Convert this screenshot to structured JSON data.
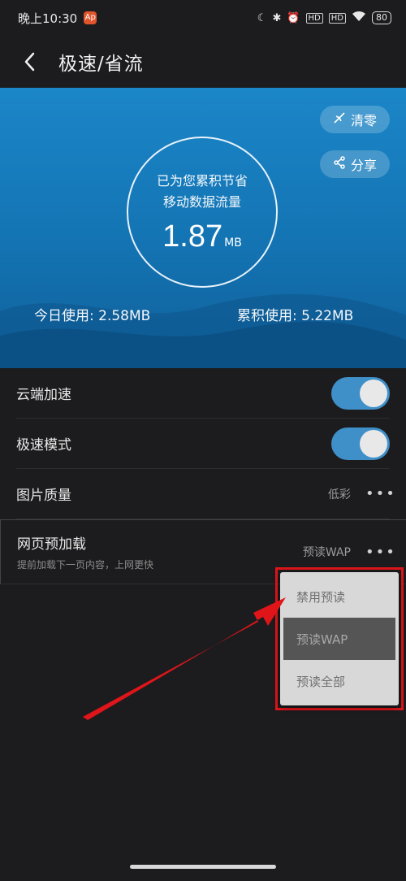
{
  "status_bar": {
    "time": "晚上10:30",
    "app_badge": "Ap",
    "signal_1": "HD",
    "signal_2": "HD",
    "battery": "80",
    "icons": [
      "moon-icon",
      "bluetooth-icon",
      "alarm-icon",
      "signal-icon",
      "wifi-icon",
      "battery-icon"
    ]
  },
  "header": {
    "title": "极速/省流"
  },
  "hero": {
    "saved_line1": "已为您累积节省",
    "saved_line2": "移动数据流量",
    "saved_value": "1.87",
    "saved_unit": "MB",
    "clear_label": "清零",
    "share_label": "分享",
    "today_usage": "今日使用: 2.58MB",
    "total_usage": "累积使用: 5.22MB"
  },
  "settings": {
    "cloud_accel": {
      "label": "云端加速",
      "enabled": true
    },
    "speed_mode": {
      "label": "极速模式",
      "enabled": true
    },
    "image_quality": {
      "label": "图片质量",
      "value": "低彩",
      "more": "•••"
    },
    "preload": {
      "label": "网页预加载",
      "subtitle": "提前加载下一页内容，上网更快",
      "value": "预读WAP",
      "more": "•••"
    }
  },
  "preload_menu": {
    "options": [
      "禁用预读",
      "预读WAP",
      "预读全部"
    ],
    "selected": "预读WAP"
  },
  "colors": {
    "hero_blue": "#1b86c8",
    "toggle_on": "#3f8fc8",
    "annotation_red": "#e0151a"
  }
}
